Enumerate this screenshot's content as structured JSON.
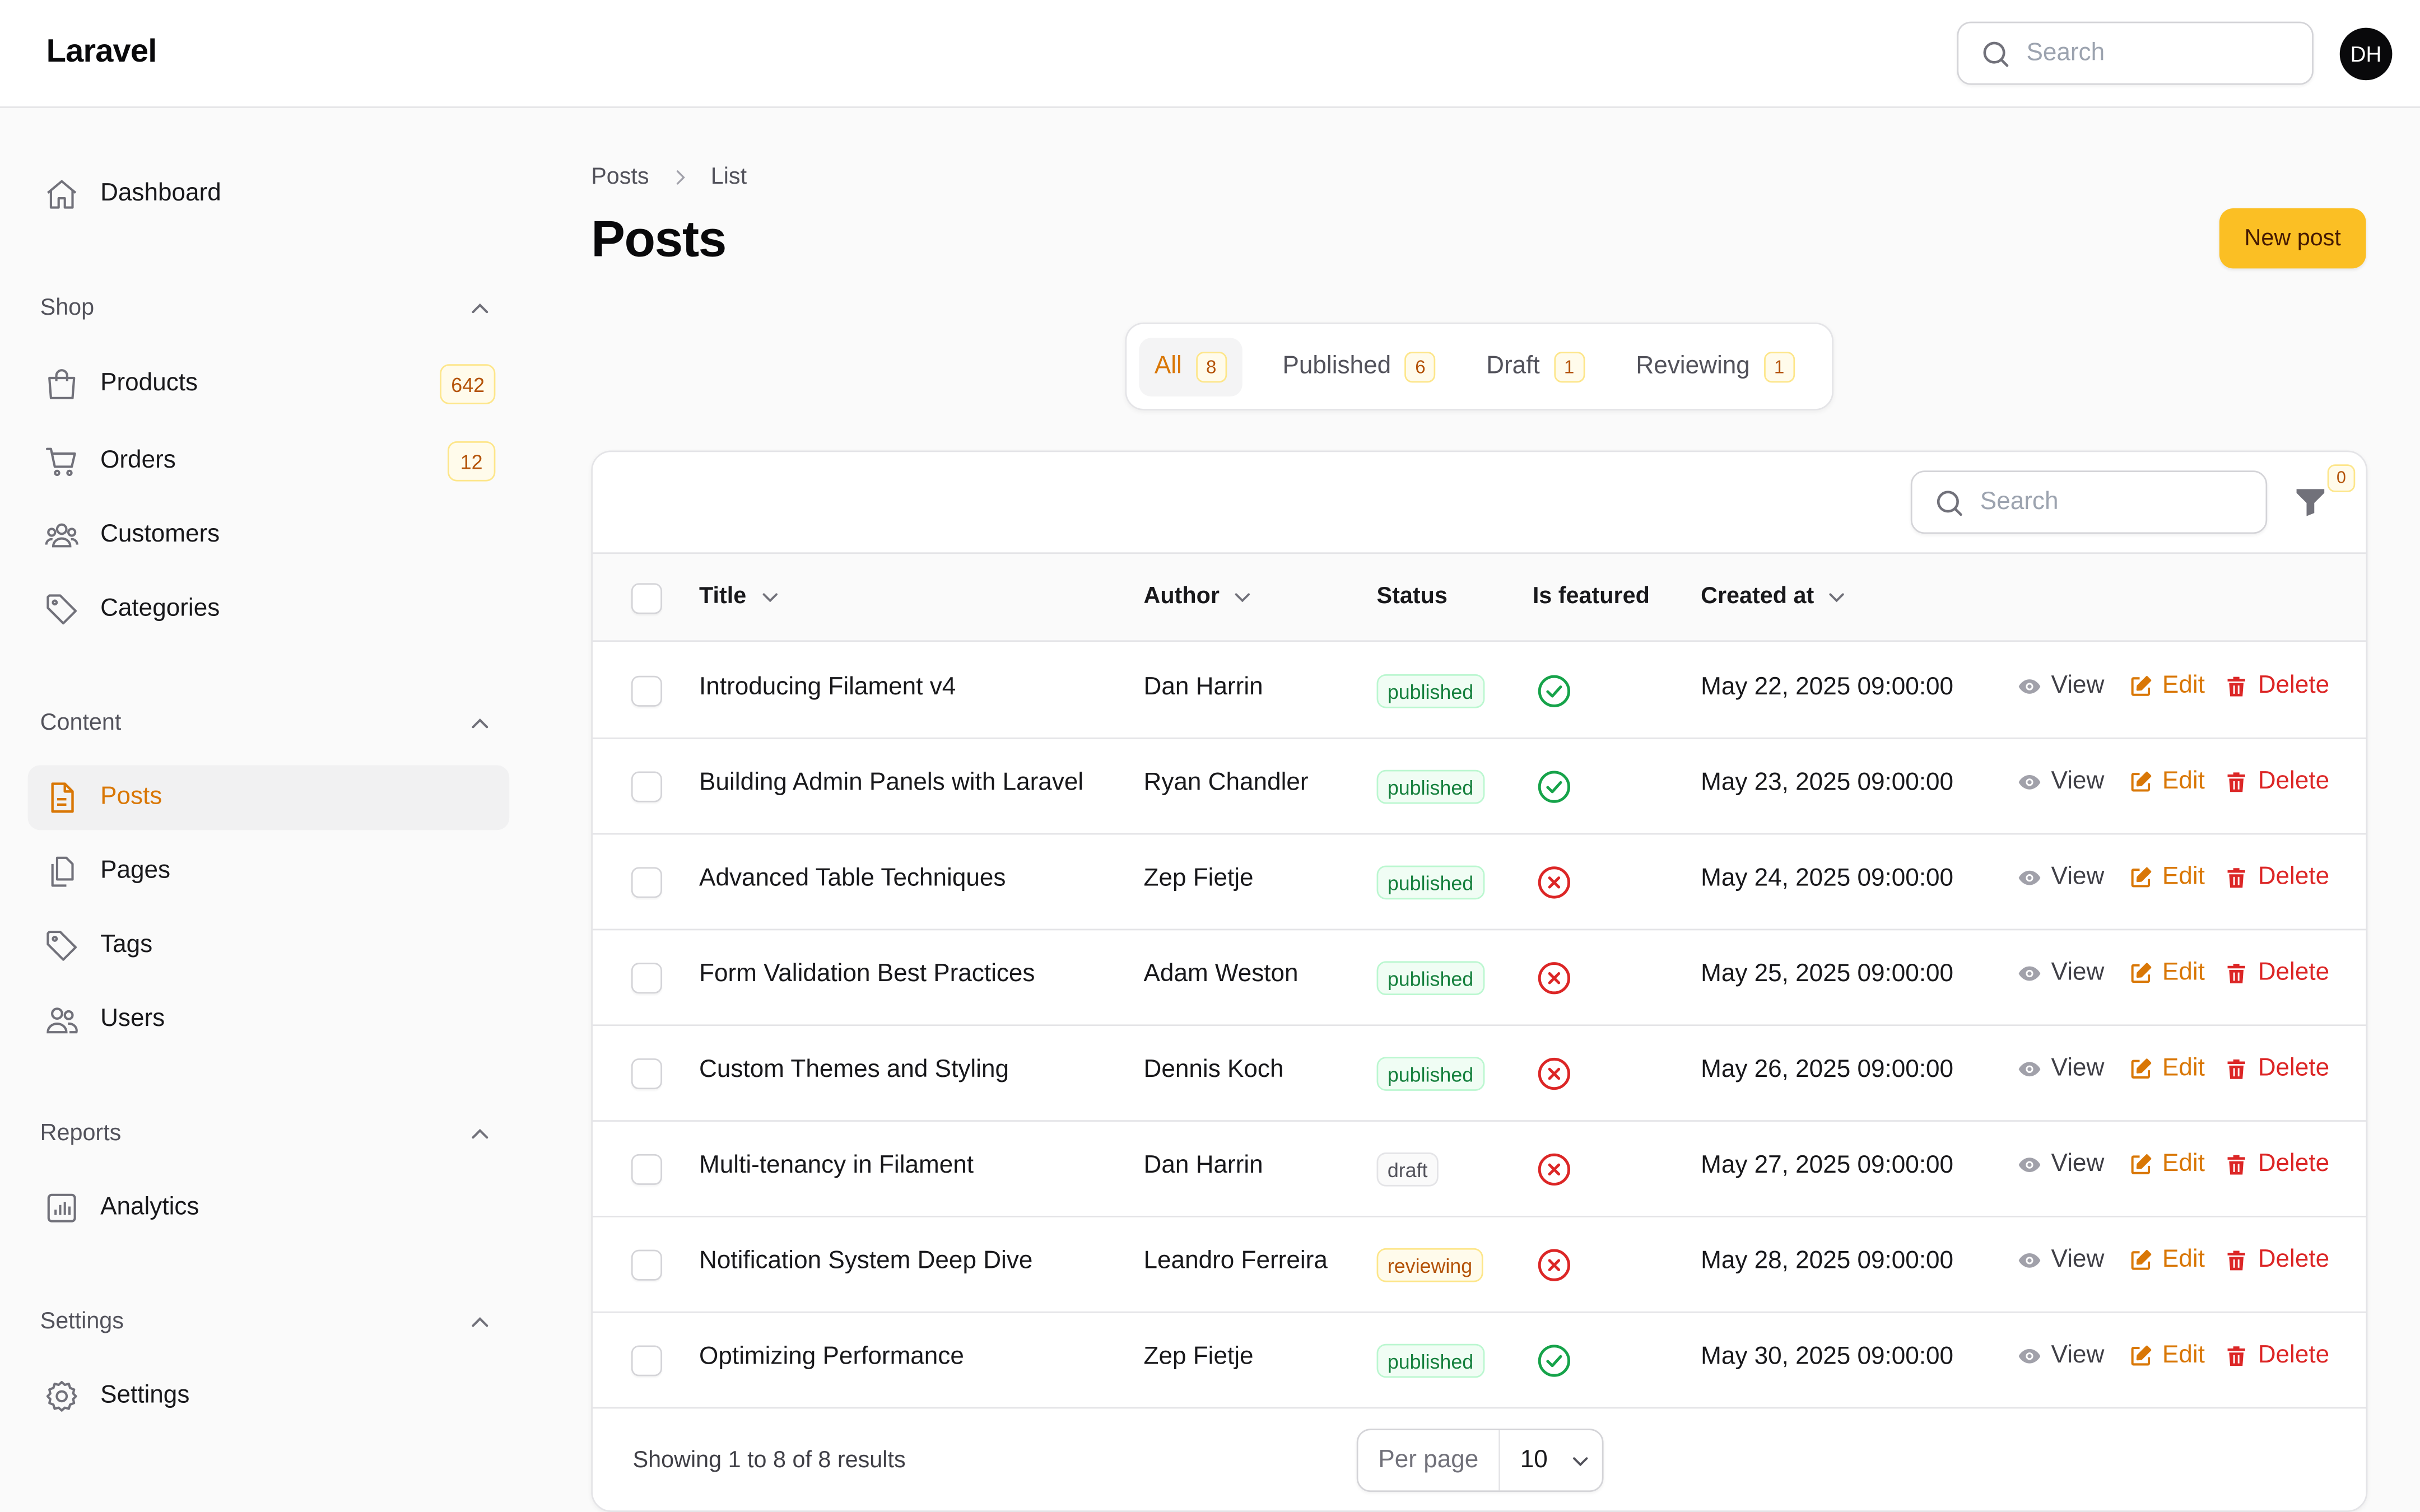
{
  "app": {
    "brand": "Laravel",
    "search_placeholder": "Search",
    "user_initials": "DH"
  },
  "sidebar": {
    "dashboard": "Dashboard",
    "groups": {
      "shop": "Shop",
      "content": "Content",
      "reports": "Reports",
      "settings": "Settings"
    },
    "items": {
      "products": {
        "label": "Products",
        "badge": "642"
      },
      "orders": {
        "label": "Orders",
        "badge": "12"
      },
      "customers": {
        "label": "Customers"
      },
      "categories": {
        "label": "Categories"
      },
      "posts": {
        "label": "Posts"
      },
      "pages": {
        "label": "Pages"
      },
      "tags": {
        "label": "Tags"
      },
      "users": {
        "label": "Users"
      },
      "analytics": {
        "label": "Analytics"
      },
      "settings": {
        "label": "Settings"
      }
    }
  },
  "header": {
    "breadcrumb": [
      "Posts",
      "List"
    ],
    "title": "Posts",
    "new_button": "New post"
  },
  "tabs": [
    {
      "label": "All",
      "count": "8",
      "active": true
    },
    {
      "label": "Published",
      "count": "6"
    },
    {
      "label": "Draft",
      "count": "1"
    },
    {
      "label": "Reviewing",
      "count": "1"
    }
  ],
  "table": {
    "search_placeholder": "Search",
    "filter_count": "0",
    "columns": {
      "title": "Title",
      "author": "Author",
      "status": "Status",
      "featured": "Is featured",
      "created": "Created at"
    },
    "actions": {
      "view": "View",
      "edit": "Edit",
      "delete": "Delete"
    },
    "rows": [
      {
        "title": "Introducing Filament v4",
        "author": "Dan Harrin",
        "status": "published",
        "featured": true,
        "created": "May 22, 2025 09:00:00"
      },
      {
        "title": "Building Admin Panels with Laravel",
        "author": "Ryan Chandler",
        "status": "published",
        "featured": true,
        "created": "May 23, 2025 09:00:00"
      },
      {
        "title": "Advanced Table Techniques",
        "author": "Zep Fietje",
        "status": "published",
        "featured": false,
        "created": "May 24, 2025 09:00:00"
      },
      {
        "title": "Form Validation Best Practices",
        "author": "Adam Weston",
        "status": "published",
        "featured": false,
        "created": "May 25, 2025 09:00:00"
      },
      {
        "title": "Custom Themes and Styling",
        "author": "Dennis Koch",
        "status": "published",
        "featured": false,
        "created": "May 26, 2025 09:00:00"
      },
      {
        "title": "Multi-tenancy in Filament",
        "author": "Dan Harrin",
        "status": "draft",
        "featured": false,
        "created": "May 27, 2025 09:00:00"
      },
      {
        "title": "Notification System Deep Dive",
        "author": "Leandro Ferreira",
        "status": "reviewing",
        "featured": false,
        "created": "May 28, 2025 09:00:00"
      },
      {
        "title": "Optimizing Performance",
        "author": "Zep Fietje",
        "status": "published",
        "featured": true,
        "created": "May 30, 2025 09:00:00"
      }
    ],
    "footer": {
      "summary": "Showing 1 to 8 of 8 results",
      "per_page_label": "Per page",
      "per_page_value": "10"
    }
  },
  "colors": {
    "accent": "#d97706",
    "primary_button": "#fbbf24",
    "success": "#16a34a",
    "danger": "#dc2626"
  }
}
